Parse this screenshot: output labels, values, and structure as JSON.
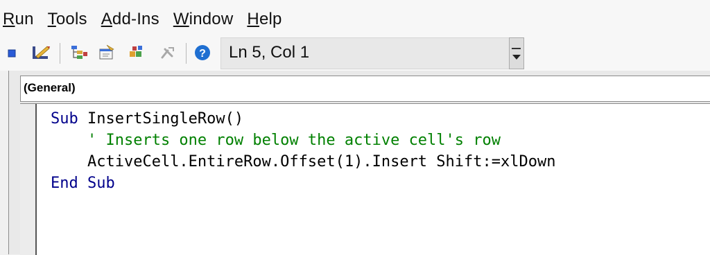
{
  "menubar": {
    "items": [
      {
        "accel": "R",
        "rest": "un"
      },
      {
        "accel": "T",
        "rest": "ools"
      },
      {
        "accel": "A",
        "rest": "dd-Ins"
      },
      {
        "accel": "W",
        "rest": "indow"
      },
      {
        "accel": "H",
        "rest": "elp"
      }
    ]
  },
  "toolbar": {
    "icons": [
      "stop-icon",
      "design-mode-icon",
      "project-explorer-icon",
      "properties-window-icon",
      "object-browser-icon",
      "toolbox-icon",
      "help-icon"
    ],
    "status": "Ln 5, Col 1"
  },
  "code_window": {
    "object_combo": "(General)",
    "lines": [
      {
        "indent": "",
        "parts": [
          {
            "type": "kw",
            "text": "Sub "
          },
          {
            "type": "id",
            "text": "InsertSingleRow()"
          }
        ]
      },
      {
        "indent": "    ",
        "parts": [
          {
            "type": "cm",
            "text": "' Inserts one row below the active cell's row"
          }
        ]
      },
      {
        "indent": "    ",
        "parts": [
          {
            "type": "id",
            "text": "ActiveCell.EntireRow.Offset(1).Insert Shift:=xlDown"
          }
        ]
      },
      {
        "indent": "",
        "parts": [
          {
            "type": "kw",
            "text": "End Sub"
          }
        ]
      }
    ]
  },
  "colors": {
    "keyword": "#00008b",
    "comment": "#008000",
    "help_icon": "#1f6fd1"
  }
}
